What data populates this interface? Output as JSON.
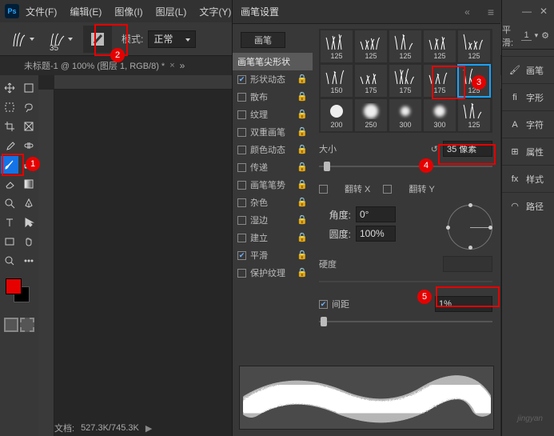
{
  "menubar": {
    "file": "文件(F)",
    "edit": "编辑(E)",
    "image": "图像(I)",
    "layer": "图层(L)",
    "type": "文字(Y)",
    "more": "···"
  },
  "optbar": {
    "brush_size": "35",
    "mode_label": "模式:",
    "mode_value": "正常"
  },
  "tabs": {
    "doc_title": "未标题-1 @ 100% (图层 1, RGB/8) *"
  },
  "status": {
    "doc_label": "文档:",
    "doc_size": "527.3K/745.3K"
  },
  "panel": {
    "title": "画笔设置",
    "brush_tab": "画笔",
    "list": {
      "tip": "画笔笔尖形状",
      "shape_dyn": "形状动态",
      "scatter": "散布",
      "texture": "纹理",
      "dual": "双重画笔",
      "color_dyn": "颜色动态",
      "transfer": "传递",
      "pose": "画笔笔势",
      "noise": "杂色",
      "wet": "湿边",
      "buildup": "建立",
      "smoothing": "平滑",
      "protect": "保护纹理"
    },
    "brushes": [
      {
        "s": "125"
      },
      {
        "s": "125"
      },
      {
        "s": "125"
      },
      {
        "s": "125"
      },
      {
        "s": "125"
      },
      {
        "s": "150"
      },
      {
        "s": "175"
      },
      {
        "s": "175"
      },
      {
        "s": "175"
      },
      {
        "s": "125"
      },
      {
        "s": "200"
      },
      {
        "s": "250"
      },
      {
        "s": "300"
      },
      {
        "s": "300"
      },
      {
        "s": "125"
      }
    ],
    "selected_index": 9,
    "size_label": "大小",
    "size_value": "35 像素",
    "flipx": "翻转 X",
    "flipy": "翻转 Y",
    "angle_label": "角度:",
    "angle_value": "0°",
    "round_label": "圆度:",
    "round_value": "100%",
    "hard_label": "硬度",
    "spacing_label": "间距",
    "spacing_value": "1%"
  },
  "dock": {
    "smooth_label": "平滑:",
    "smooth_value": "1",
    "items": [
      {
        "icon": "brush",
        "label": "画笔"
      },
      {
        "icon": "glyph",
        "label": "字形"
      },
      {
        "icon": "char",
        "label": "字符"
      },
      {
        "icon": "props",
        "label": "属性"
      },
      {
        "icon": "styles",
        "label": "样式"
      },
      {
        "icon": "paths",
        "label": "路径"
      }
    ]
  },
  "callouts": {
    "n1": "1",
    "n2": "2",
    "n3": "3",
    "n4": "4",
    "n5": "5"
  },
  "watermark": "jingyan"
}
